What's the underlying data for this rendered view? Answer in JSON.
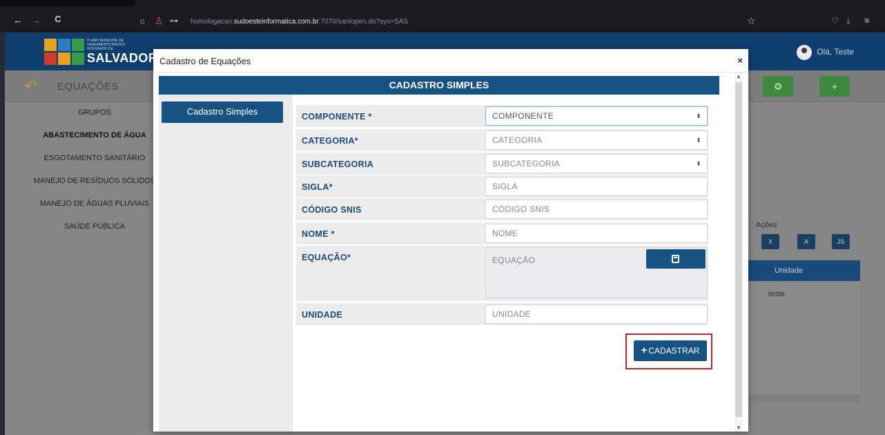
{
  "browser": {
    "back_icon": "←",
    "forward_icon": "→",
    "reload_icon": "C",
    "url_prefix": "homologacao.",
    "url_domain": "sudoesteinformatica.com.br",
    "url_suffix": ":7070/san/open.do?sys=SAS",
    "bookmark_icon": "☆"
  },
  "header": {
    "logo_small_text": "PLANO MUNICIPAL DE SANEAMENTO BÁSICO INTEGRADO DE",
    "logo_big_text": "SALVADOR",
    "user_greeting": "Olá, Teste"
  },
  "page": {
    "title": "EQUAÇÕES",
    "sidebar": [
      {
        "label": "GRUPOS",
        "bold": false
      },
      {
        "label": "ABASTECIMENTO DE ÁGUA",
        "bold": true
      },
      {
        "label": "ESGOTAMENTO SANITÁRIO",
        "bold": false
      },
      {
        "label": "MANEJO DE RESÍDUOS SÓLIDOS",
        "bold": false
      },
      {
        "label": "MANEJO DE ÁGUAS PLUVIAIS",
        "bold": false
      },
      {
        "label": "SAÚDE PÚBLICA",
        "bold": false
      }
    ],
    "actions_label": "Ações",
    "table_header": "Unidade",
    "table_cell": "teste"
  },
  "modal": {
    "title": "Cadastro de Equações",
    "close_label": "×",
    "banner": "CADASTRO SIMPLES",
    "tab_label": "Cadastro Simples",
    "fields": {
      "componente": {
        "label": "COMPONENTE *",
        "value": "COMPONENTE"
      },
      "categoria": {
        "label": "CATEGORIA*",
        "value": "CATEGORIA"
      },
      "subcategoria": {
        "label": "SUBCATEGORIA",
        "value": "SUBCATEGORIA"
      },
      "sigla": {
        "label": "SIGLA*",
        "placeholder": "SIGLA"
      },
      "codigo_snis": {
        "label": "CÓDIGO SNIS",
        "placeholder": "CÓDIGO SNIS"
      },
      "nome": {
        "label": "NOME *",
        "placeholder": "NOME"
      },
      "equacao": {
        "label": "EQUAÇÃO*",
        "placeholder": "EQUAÇÃO"
      },
      "unidade": {
        "label": "UNIDADE",
        "placeholder": "UNIDADE"
      }
    },
    "submit_label": "CADASTRAR"
  },
  "colors": {
    "primary": "#175282",
    "header_bg": "#0e3f6e",
    "highlight": "#c0252b",
    "label": "#1a4a7a"
  }
}
